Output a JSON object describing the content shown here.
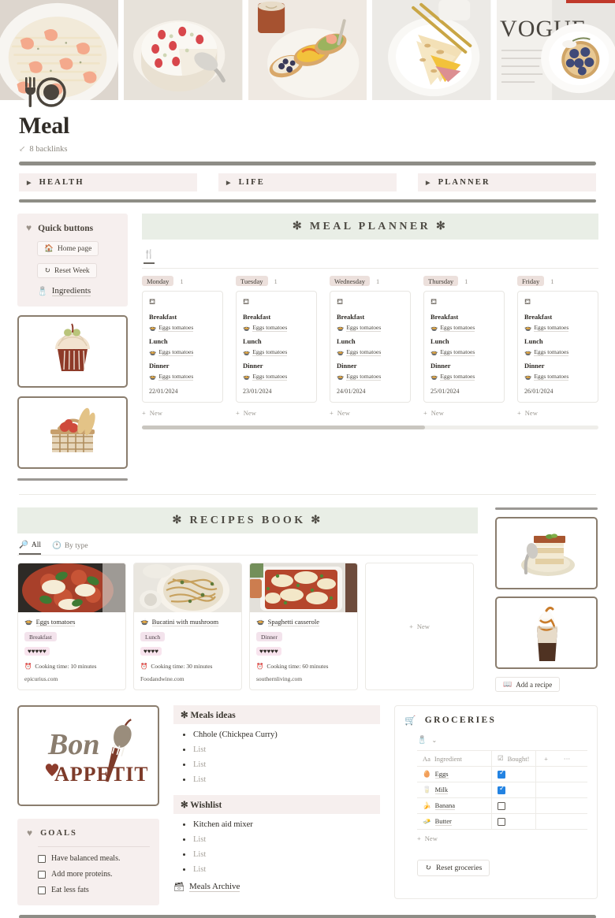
{
  "header": {
    "title": "Meal",
    "backlinks": "8 backlinks",
    "backlink_icon": "arrow-down-left-icon",
    "logo_icon": "fork-plate-icon"
  },
  "hero": {
    "images": [
      {
        "name": "shrimp-pasta-photo",
        "alt": "Creamy shrimp pasta in white bowl"
      },
      {
        "name": "strawberry-cheesecake-photo",
        "alt": "Strawberry cheesecake with server"
      },
      {
        "name": "breakfast-toast-photo",
        "alt": "Avocado and egg toasts with coffee"
      },
      {
        "name": "quesadilla-photo",
        "alt": "Egg quesadilla on plate with gold cutlery"
      },
      {
        "name": "blueberry-tart-photo",
        "alt": "Blueberry tart on Vogue magazine"
      }
    ],
    "accent_color": "#c0392b"
  },
  "nav": {
    "tabs": [
      {
        "label": "HEALTH",
        "name": "nav-tab-health"
      },
      {
        "label": "LIFE",
        "name": "nav-tab-life"
      },
      {
        "label": "PLANNER",
        "name": "nav-tab-planner"
      }
    ]
  },
  "quick_buttons": {
    "title": "Quick buttons",
    "heart_icon": "heart-icon",
    "items": [
      {
        "label": "Home page",
        "icon": "home-icon"
      },
      {
        "label": "Reset Week",
        "icon": "reset-icon"
      }
    ],
    "link": {
      "label": "Ingredients",
      "icon": "ingredients-icon"
    }
  },
  "left_images": [
    {
      "name": "cupcake-image-card",
      "alt": "Cupcake illustration"
    },
    {
      "name": "picnic-basket-image-card",
      "alt": "Picnic basket with bread and apples"
    }
  ],
  "planner": {
    "heading": "✻ MEAL PLANNER ✻",
    "tab_icon": "cutlery-icon",
    "meal_labels": {
      "breakfast": "Breakfast",
      "lunch": "Lunch",
      "dinner": "Dinner"
    },
    "new_label": "New",
    "card_icon": "bell-icon",
    "meal_icon": "bowl-icon",
    "scroll_percent": 62,
    "days": [
      {
        "name": "Monday",
        "count": "1",
        "breakfast": "Eggs tomatoes",
        "lunch": "Eggs tomatoes",
        "dinner": "Eggs tomatoes",
        "date": "22/01/2024"
      },
      {
        "name": "Tuesday",
        "count": "1",
        "breakfast": "Eggs tomatoes",
        "lunch": "Eggs tomatoes",
        "dinner": "Eggs tomatoes",
        "date": "23/01/2024"
      },
      {
        "name": "Wednesday",
        "count": "1",
        "breakfast": "Eggs tomatoes",
        "lunch": "Eggs tomatoes",
        "dinner": "Eggs tomatoes",
        "date": "24/01/2024"
      },
      {
        "name": "Thursday",
        "count": "1",
        "breakfast": "Eggs tomatoes",
        "lunch": "Eggs tomatoes",
        "dinner": "Eggs tomatoes",
        "date": "25/01/2024"
      },
      {
        "name": "Friday",
        "count": "1",
        "breakfast": "Eggs tomatoes",
        "lunch": "Eggs tomatoes",
        "dinner": "Eggs tomatoes",
        "date": "26/01/2024"
      }
    ]
  },
  "recipes": {
    "heading": "✻ RECIPES BOOK ✻",
    "tabs": [
      {
        "label": "All",
        "icon": "search-icon",
        "active": true
      },
      {
        "label": "By type",
        "icon": "clock-icon",
        "active": false
      }
    ],
    "new_label": "New",
    "bowl_icon": "bowl-icon",
    "timer_icon": "timer-icon",
    "cards": [
      {
        "title": "Eggs tomatoes",
        "tag": "Breakfast",
        "hearts": 5,
        "cook": "Cooking time: 10 minutes",
        "source": "epicurius.com",
        "image_alt": "Eggs in tomato sauce skillet"
      },
      {
        "title": "Bucatini with mushroom",
        "tag": "Lunch",
        "hearts": 4,
        "cook": "Cooking time: 30 minutes",
        "source": "Foodandwine.com",
        "image_alt": "Bucatini pasta with mushrooms"
      },
      {
        "title": "Spaghetti casserole",
        "tag": "Dinner",
        "hearts": 5,
        "cook": "Cooking time: 60 minutes",
        "source": "southernliving.com",
        "image_alt": "Baked spaghetti casserole dish"
      }
    ],
    "side_images": [
      {
        "name": "tiramisu-image-card",
        "alt": "Tiramisu slice on plate with spoon"
      },
      {
        "name": "iced-coffee-image-card",
        "alt": "Iced caramel coffee with whipped cream"
      }
    ],
    "add_button": {
      "label": "Add a recipe",
      "icon": "book-icon"
    }
  },
  "bon_appetit": {
    "name": "bon-appetit-image-card",
    "alt": "Bon Appetit logo with fork and beet"
  },
  "goals": {
    "title": "GOALS",
    "heart_icon": "heart-icon",
    "items": [
      {
        "label": "Have balanced meals.",
        "checked": false
      },
      {
        "label": "Add more proteins.",
        "checked": false
      },
      {
        "label": "Eat less fats",
        "checked": false
      }
    ]
  },
  "meals_ideas": {
    "title": "✻ Meals ideas",
    "items": [
      {
        "label": "Chhole (Chickpea Curry)",
        "placeholder": false
      },
      {
        "label": "List",
        "placeholder": true
      },
      {
        "label": "List",
        "placeholder": true
      },
      {
        "label": "List",
        "placeholder": true
      }
    ]
  },
  "wishlist": {
    "title": "✻ Wishlist",
    "items": [
      {
        "label": "Kitchen aid mixer",
        "placeholder": false
      },
      {
        "label": "List",
        "placeholder": true
      },
      {
        "label": "List",
        "placeholder": true
      },
      {
        "label": "List",
        "placeholder": true
      }
    ],
    "archive": {
      "label": "Meals Archive",
      "icon": "archive-icon"
    }
  },
  "groceries": {
    "title": "GROCERIES",
    "cart_icon": "shopping-cart-icon",
    "db_icon": "ingredients-icon",
    "chevron_icon": "chevron-down-icon",
    "columns": [
      {
        "label": "Ingredient",
        "icon": "text-type-icon"
      },
      {
        "label": "Bought!",
        "icon": "checkbox-type-icon"
      }
    ],
    "add_column_icon": "plus-icon",
    "more_icon": "ellipsis-icon",
    "rows": [
      {
        "name": "Eggs",
        "icon": "egg-icon",
        "bought": true
      },
      {
        "name": "Milk",
        "icon": "milk-icon",
        "bought": true
      },
      {
        "name": "Banana",
        "icon": "banana-icon",
        "bought": false
      },
      {
        "name": "Butter",
        "icon": "butter-icon",
        "bought": false
      }
    ],
    "new_label": "New",
    "reset_button": {
      "label": "Reset groceries",
      "icon": "reset-icon"
    },
    "checked_color": "#2383e2"
  }
}
